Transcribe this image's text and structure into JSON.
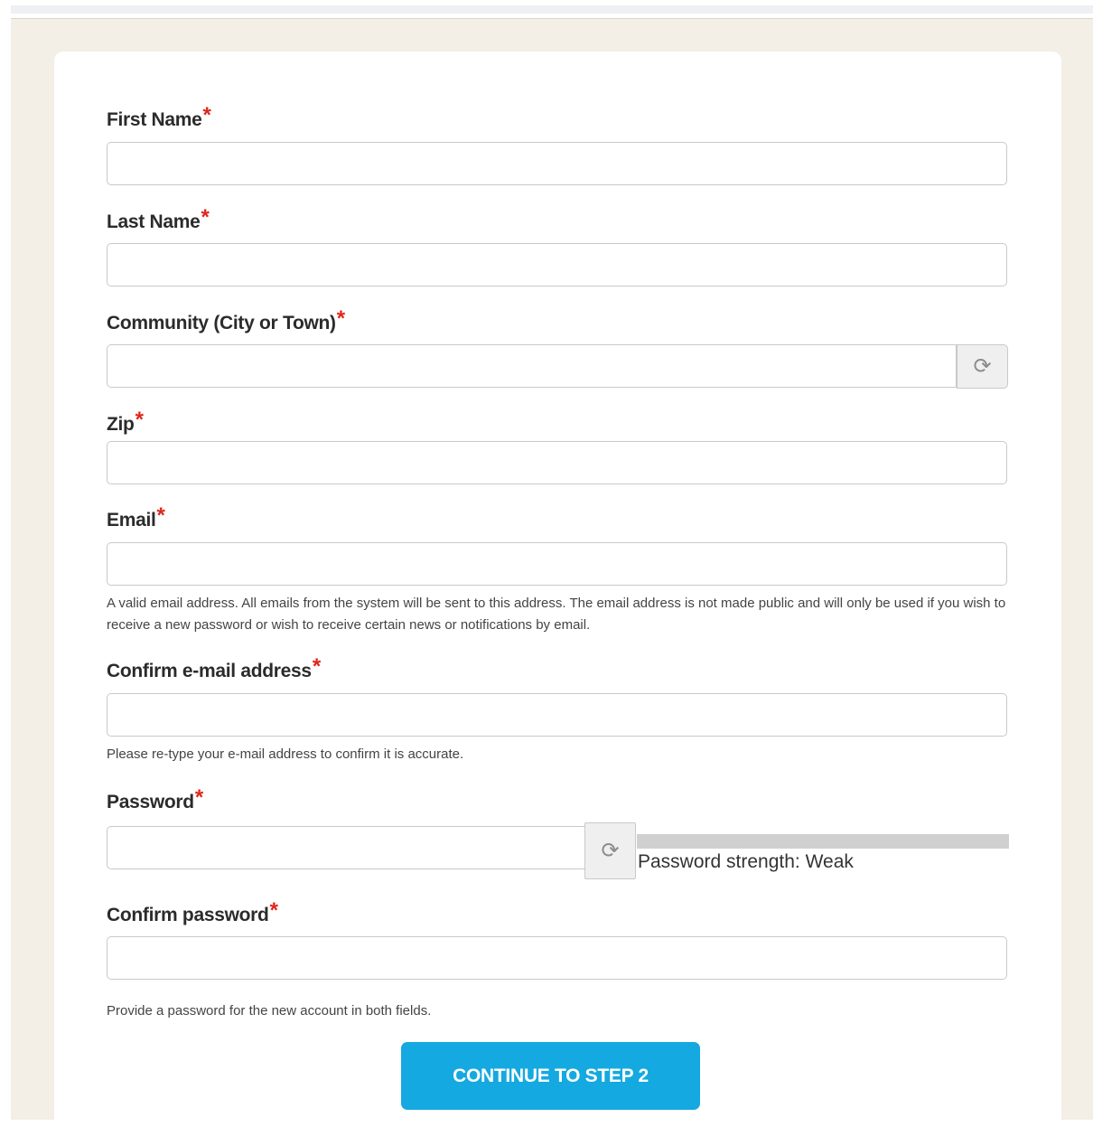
{
  "form": {
    "first_name": {
      "label": "First Name",
      "required_mark": "*",
      "value": ""
    },
    "last_name": {
      "label": "Last Name",
      "required_mark": "*",
      "value": ""
    },
    "community": {
      "label": "Community (City or Town)",
      "required_mark": "*",
      "value": "",
      "addon_icon": "refresh-icon"
    },
    "zip": {
      "label": "Zip",
      "required_mark": "*",
      "value": ""
    },
    "email": {
      "label": "Email",
      "required_mark": "*",
      "value": "",
      "help": "A valid email address. All emails from the system will be sent to this address. The email address is not made public and will only be used if you wish to receive a new password or wish to receive certain news or notifications by email."
    },
    "confirm_email": {
      "label": "Confirm e-mail address",
      "required_mark": "*",
      "value": "",
      "help": "Please re-type your e-mail address to confirm it is accurate."
    },
    "password": {
      "label": "Password",
      "required_mark": "*",
      "value": "",
      "addon_icon": "refresh-icon",
      "strength_text": "Password strength: Weak"
    },
    "confirm_password": {
      "label": "Confirm password",
      "required_mark": "*",
      "value": "",
      "help": "Provide a password for the new account in both fields."
    },
    "submit_label": "CONTINUE TO STEP 2"
  },
  "colors": {
    "accent": "#14a9e0",
    "required": "#e0261b",
    "page_bg": "#f3eee6"
  }
}
